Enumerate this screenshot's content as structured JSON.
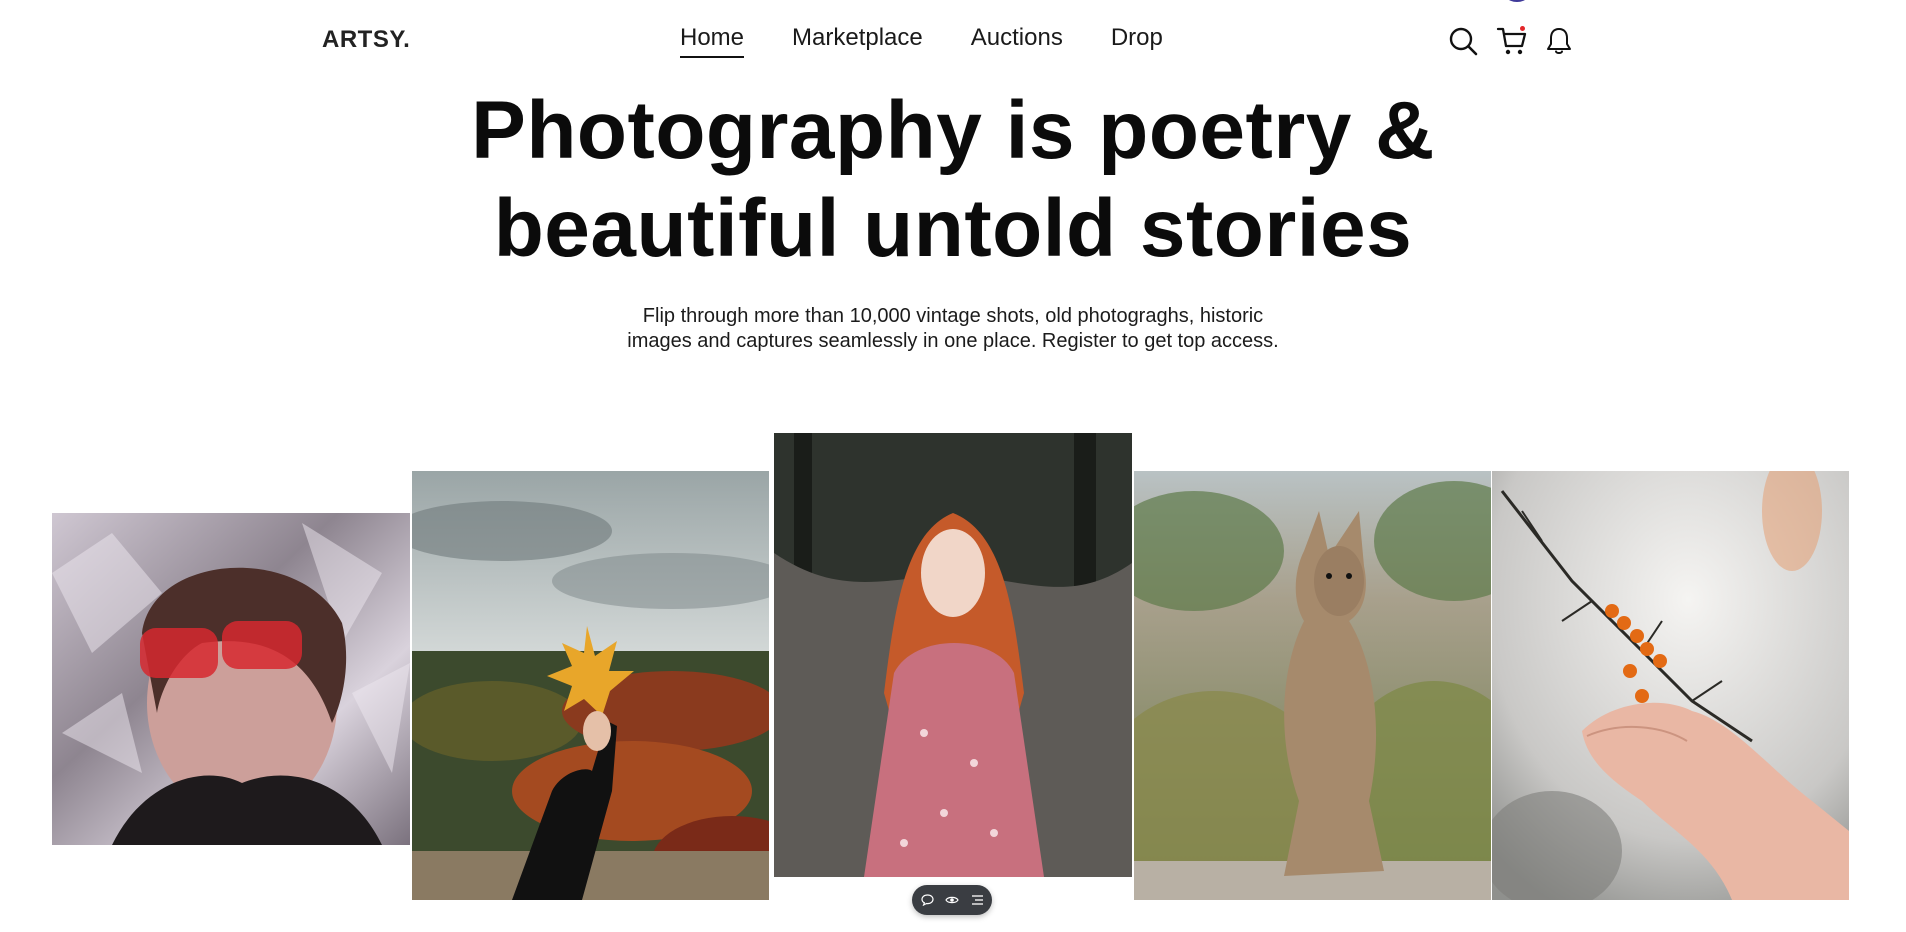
{
  "brand": {
    "logo": "ARTSY."
  },
  "nav": {
    "items": [
      {
        "label": "Home",
        "active": true
      },
      {
        "label": "Marketplace",
        "active": false
      },
      {
        "label": "Auctions",
        "active": false
      },
      {
        "label": "Drop",
        "active": false
      }
    ]
  },
  "header_icons": [
    "search-icon",
    "cart-icon",
    "bell-icon"
  ],
  "hero": {
    "title_line1": "Photography is poetry &",
    "title_line2": "beautiful untold stories",
    "subtitle_line1": "Flip through more than 10,000 vintage shots, old photograghs, historic",
    "subtitle_line2": "images and captures seamlessly in one place. Register to get top access."
  },
  "gallery": {
    "photos": [
      {
        "name": "photo-boy-red-sunglasses"
      },
      {
        "name": "photo-hand-holding-maple-leaf"
      },
      {
        "name": "photo-redhead-girl-pink-dress"
      },
      {
        "name": "photo-kangaroo"
      },
      {
        "name": "photo-hand-with-berries"
      }
    ]
  },
  "toolbar": {
    "icons": [
      "comment-icon",
      "eye-icon",
      "list-icon"
    ]
  },
  "colors": {
    "accent": "#111111",
    "notification_dot": "#e3262a",
    "toolbar_bg": "#3a3d42"
  }
}
